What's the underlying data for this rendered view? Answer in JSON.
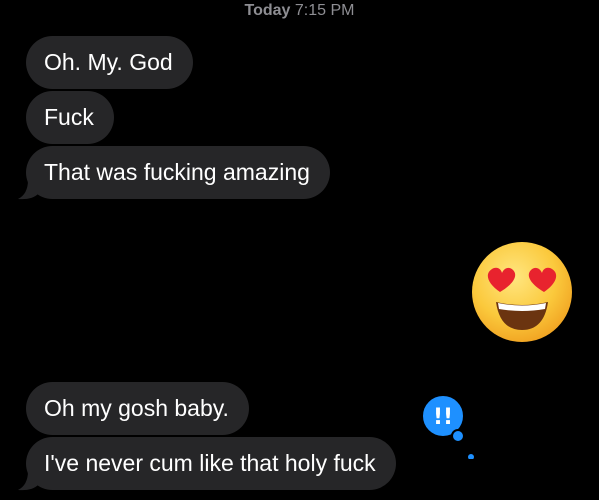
{
  "conversation": {
    "timestamp": {
      "day": "Today",
      "time": "7:15 PM"
    },
    "incoming_group_1": [
      {
        "text": "Oh. My. God"
      },
      {
        "text": "Fuck"
      },
      {
        "text": "That was fucking amazing"
      }
    ],
    "outgoing_emoji": {
      "emoji": "smiling face with heart-eyes"
    },
    "incoming_group_2": [
      {
        "text": "Oh my gosh baby."
      },
      {
        "text": "I've never cum like that holy fuck"
      }
    ],
    "reaction": {
      "type": "emphasis",
      "glyph": "!!",
      "color": "#1e90ff"
    }
  },
  "colors": {
    "background": "#000000",
    "incoming_bubble": "#262628",
    "timestamp_text": "#8e8e93",
    "message_text": "#ffffff",
    "reaction_blue": "#1e90ff"
  }
}
